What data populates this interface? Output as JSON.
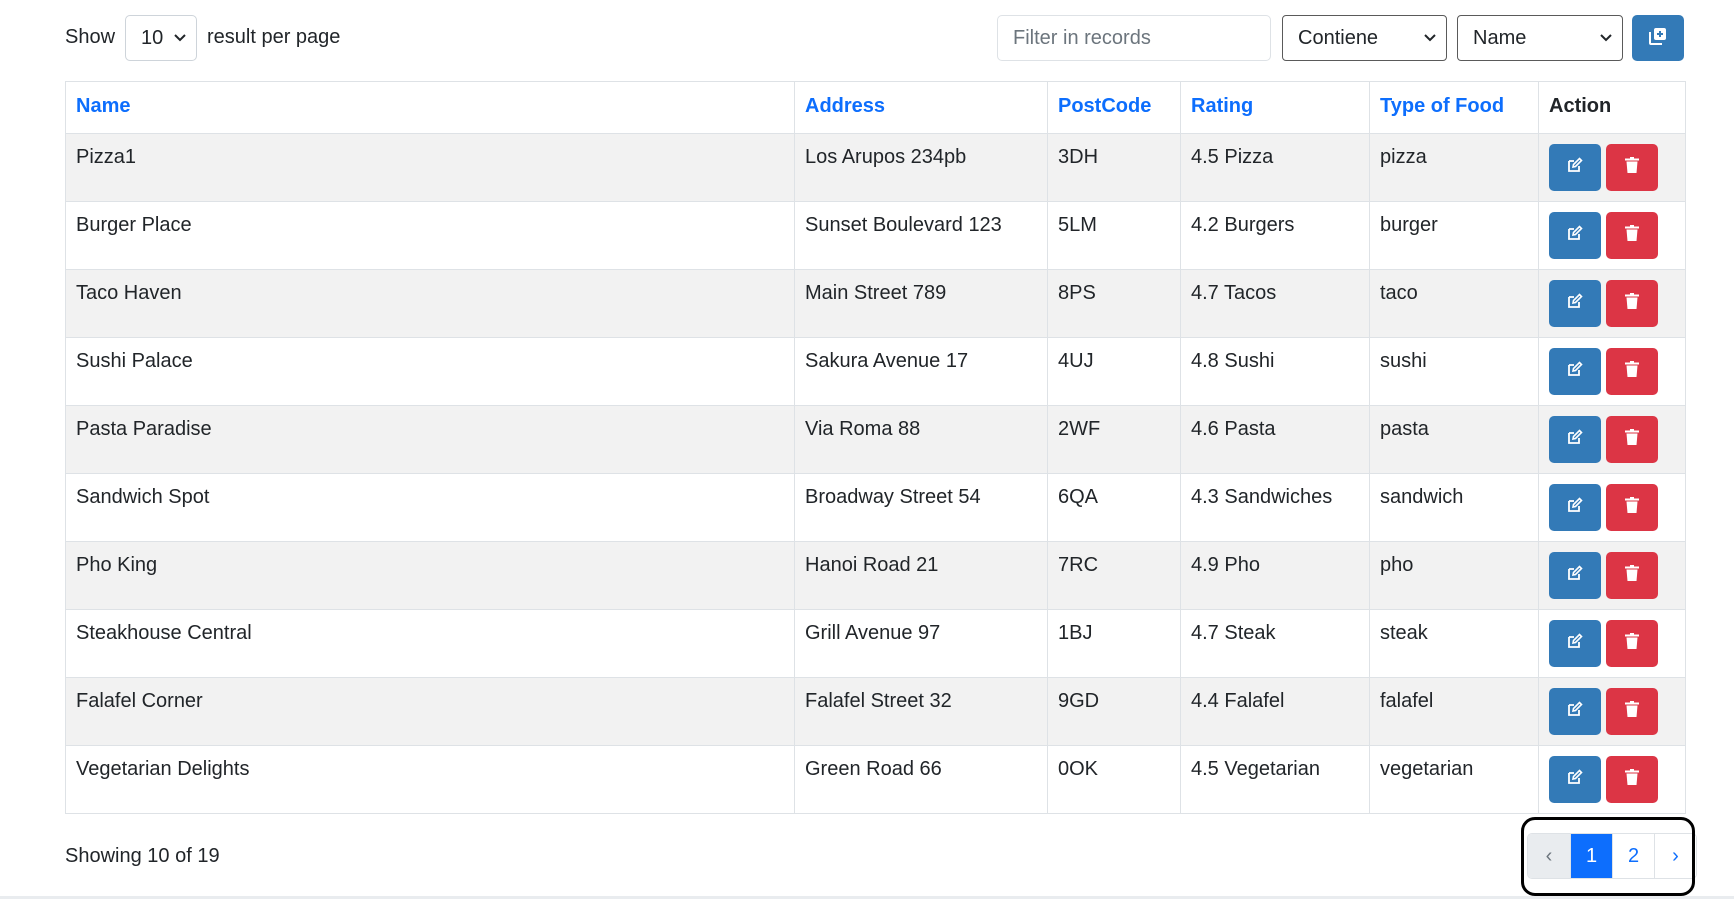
{
  "toolbar": {
    "show_label": "Show",
    "per_page_value": "10",
    "per_page_suffix": "result per page",
    "filter_placeholder": "Filter in records",
    "operator_value": "Contiene",
    "field_value": "Name"
  },
  "table": {
    "headers": [
      "Name",
      "Address",
      "PostCode",
      "Rating",
      "Type of Food",
      "Action"
    ],
    "rows": [
      [
        "Pizza1",
        "Los Arupos 234pb",
        "3DH",
        "4.5 Pizza",
        "pizza"
      ],
      [
        "Burger Place",
        "Sunset Boulevard 123",
        "5LM",
        "4.2 Burgers",
        "burger"
      ],
      [
        "Taco Haven",
        "Main Street 789",
        "8PS",
        "4.7 Tacos",
        "taco"
      ],
      [
        "Sushi Palace",
        "Sakura Avenue 17",
        "4UJ",
        "4.8 Sushi",
        "sushi"
      ],
      [
        "Pasta Paradise",
        "Via Roma 88",
        "2WF",
        "4.6 Pasta",
        "pasta"
      ],
      [
        "Sandwich Spot",
        "Broadway Street 54",
        "6QA",
        "4.3 Sandwiches",
        "sandwich"
      ],
      [
        "Pho King",
        "Hanoi Road 21",
        "7RC",
        "4.9 Pho",
        "pho"
      ],
      [
        "Steakhouse Central",
        "Grill Avenue 97",
        "1BJ",
        "4.7 Steak",
        "steak"
      ],
      [
        "Falafel Corner",
        "Falafel Street 32",
        "9GD",
        "4.4 Falafel",
        "falafel"
      ],
      [
        "Vegetarian Delights",
        "Green Road 66",
        "0OK",
        "4.5 Vegetarian",
        "vegetarian"
      ]
    ]
  },
  "footer": {
    "showing_text": "Showing 10 of 19",
    "pagination": {
      "prev": "‹",
      "pages": [
        "1",
        "2"
      ],
      "next": "›"
    }
  },
  "colors": {
    "primary": "#337ab7",
    "danger": "#dc3545",
    "link": "#0d6efd",
    "active_page": "#0d6efd"
  },
  "icons": {
    "add": "copy-plus-icon",
    "edit": "edit-icon",
    "delete": "trash-icon"
  }
}
